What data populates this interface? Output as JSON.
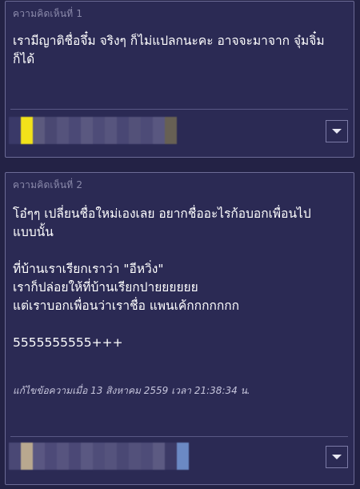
{
  "comments": [
    {
      "label": "ความคิดเห็นที่ 1",
      "lines": [
        "เรามีญาติชื่อจึ๋ม จริงๆ ก็ไม่แปลกนะคะ อาจจะมาจาก จุ๋มจิ๋ม",
        "ก็ได้"
      ],
      "author_name": "[blurred]",
      "menu_icon": "chevron-down-icon"
    },
    {
      "label": "ความคิดเห็นที่ 2",
      "lines": [
        "โอ๋ๆๆ เปลี่ยนชื่อใหม่เองเลย อยากชื่ออะไรก้อบอกเพื่อนไป",
        "แบบนั้น",
        "",
        "ที่บ้านเราเรียกเราว่า \"อีหวิ่ง\"",
        "เราก็ปล่อยให้ที่บ้านเรียกปายยยยยย",
        "แต่เราบอกเพื่อนว่าเราชื่อ แพนเค้กกกกกกก",
        "",
        "5555555555+++"
      ],
      "edited_note": "แก้ไขข้อความเมื่อ 13 สิงหาคม 2559 เวลา 21:38:34 น.",
      "author_name": "[blurred]",
      "menu_icon": "chevron-down-icon"
    }
  ]
}
